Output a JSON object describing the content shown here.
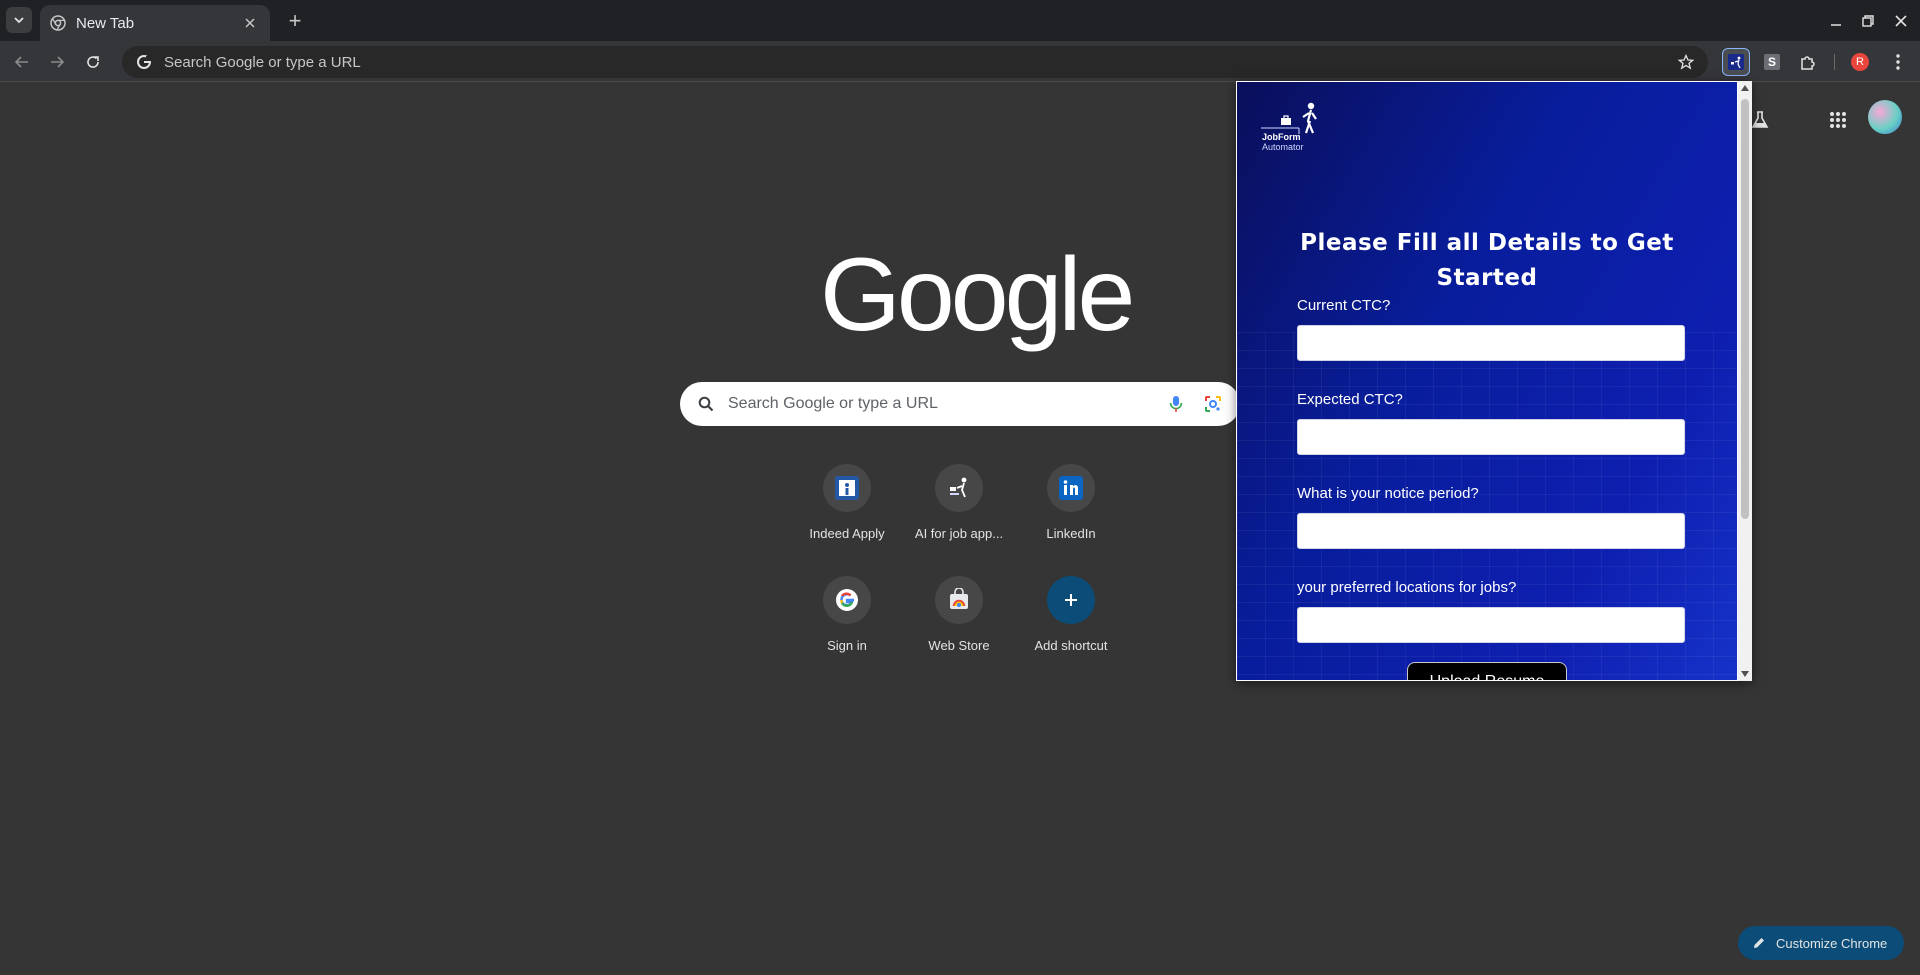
{
  "browser": {
    "tab_title": "New Tab",
    "new_tab_symbol": "+",
    "omnibox_placeholder": "Search Google or type a URL",
    "profile_initial": "R",
    "extension_s_letter": "S"
  },
  "ntp": {
    "logo_text": "Google",
    "search_placeholder": "Search Google or type a URL",
    "shortcuts": [
      {
        "label": "Indeed Apply",
        "icon": "indeed-icon"
      },
      {
        "label": "AI for job app...",
        "icon": "jobform-automator-icon"
      },
      {
        "label": "LinkedIn",
        "icon": "linkedin-icon"
      },
      {
        "label": "Sign in",
        "icon": "google-g-icon"
      },
      {
        "label": "Web Store",
        "icon": "web-store-icon"
      },
      {
        "label": "Add shortcut",
        "icon": "plus-icon"
      }
    ],
    "customize_label": "Customize Chrome"
  },
  "popup": {
    "logo_line1": "JobForm",
    "logo_line2": "Automator",
    "title": "Please Fill all Details to Get Started",
    "fields": [
      {
        "label": "Current CTC?",
        "value": ""
      },
      {
        "label": "Expected CTC?",
        "value": ""
      },
      {
        "label": "What is your notice period?",
        "value": ""
      },
      {
        "label": "your preferred locations for jobs?",
        "value": ""
      }
    ],
    "upload_label": "Upload Resume"
  },
  "colors": {
    "popup_gradient_start": "#0a0f5a",
    "popup_gradient_end": "#1632c8",
    "customize_bg": "#0b4d78",
    "profile_badge": "#e8453c"
  }
}
